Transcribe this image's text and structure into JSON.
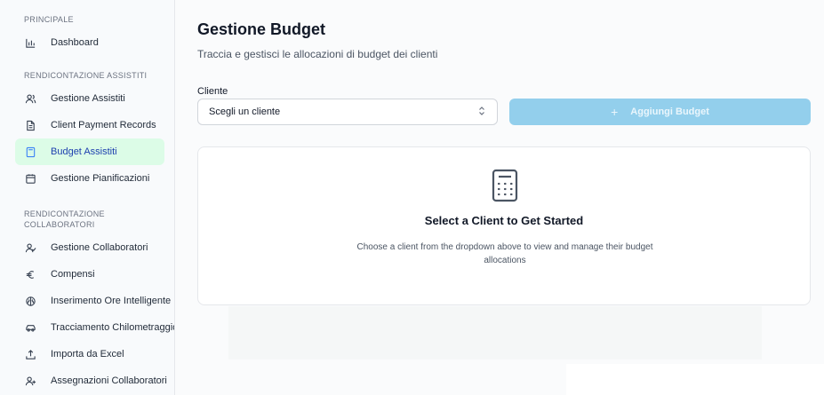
{
  "sidebar": {
    "sections": [
      {
        "title": "PRINCIPALE",
        "items": [
          {
            "label": "Dashboard",
            "icon": "bar-chart-icon"
          }
        ]
      },
      {
        "title": "RENDICONTAZIONE ASSISTITI",
        "items": [
          {
            "label": "Gestione Assistiti",
            "icon": "users-icon"
          },
          {
            "label": "Client Payment Records",
            "icon": "document-icon"
          },
          {
            "label": "Budget Assistiti",
            "icon": "calculator-icon",
            "active": true
          },
          {
            "label": "Gestione Pianificazioni",
            "icon": "calendar-icon"
          }
        ]
      },
      {
        "title": "RENDICONTAZIONE COLLABORATORI",
        "items": [
          {
            "label": "Gestione Collaboratori",
            "icon": "user-check-icon"
          },
          {
            "label": "Compensi",
            "icon": "euro-icon"
          },
          {
            "label": "Inserimento Ore Intelligente",
            "icon": "brain-icon"
          },
          {
            "label": "Tracciamento Chilometraggio",
            "icon": "car-icon"
          },
          {
            "label": "Importa da Excel",
            "icon": "upload-icon"
          },
          {
            "label": "Assegnazioni Collaboratori",
            "icon": "user-plus-icon"
          }
        ]
      }
    ]
  },
  "main": {
    "title": "Gestione Budget",
    "subtitle": "Traccia e gestisci le allocazioni di budget dei clienti",
    "client_label": "Cliente",
    "client_select_value": "Scegli un cliente",
    "add_button_label": "Aggiungi Budget",
    "empty_state": {
      "title": "Select a Client to Get Started",
      "description": "Choose a client from the dropdown above to view and manage their budget allocations"
    }
  },
  "colors": {
    "active_nav_bg": "#dcfce7",
    "active_nav_text": "#1e40af",
    "add_button_bg": "#93cfec"
  }
}
